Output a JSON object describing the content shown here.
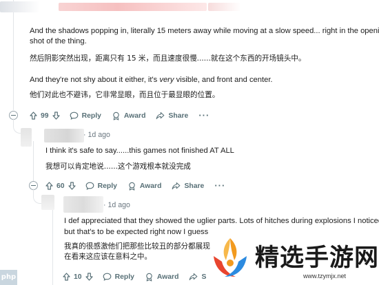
{
  "colors": {
    "action_gray": "#576f76",
    "time_gray": "#6b7780",
    "thread_line": "#e2e5e8",
    "watermark_orange": "#f29a1f",
    "watermark_red": "#e8452f",
    "watermark_blue": "#2c8be0"
  },
  "top_comment": {
    "paragraphs": [
      "And the shadows popping in, literally 15 meters away while moving at a slow speed... right in the opening",
      "shot of the thing.",
      "然后阴影突然出现，距离只有 15 米，而且速度很慢......就在这个东西的开场镜头中。"
    ],
    "p2_before": "And they're not shy about it either, it's ",
    "p2_em": "very",
    "p2_after": " visible, and front and center.",
    "p2_translation": "他们对此也不避讳，它非常显眼，而且位于最显眼的位置。",
    "actions": {
      "votes": "99",
      "reply": "Reply",
      "award": "Award",
      "share": "Share",
      "more": "···"
    }
  },
  "reply_1": {
    "time": "1d ago",
    "text": "I think it's safe to say......this games not finished AT ALL",
    "translation": "我想可以肯定地说......这个游戏根本就没完成",
    "actions": {
      "votes": "60",
      "reply": "Reply",
      "award": "Award",
      "share": "Share",
      "more": "···"
    }
  },
  "reply_2": {
    "time": "1d ago",
    "line1": "I def appreciated that they showed the uglier parts. Lots of hitches during explosions I noticed",
    "line2": "but that's to be expected right now I guess",
    "translation1": "我真的很感激他们把那些比较丑的部分都展现",
    "translation2": "在看来这应该在意料之中。",
    "actions": {
      "votes": "10",
      "reply": "Reply",
      "award": "Award",
      "share": "S"
    }
  },
  "badge": "php",
  "watermark": {
    "text": "精选手游网",
    "url": "www.tzymjx.net"
  }
}
